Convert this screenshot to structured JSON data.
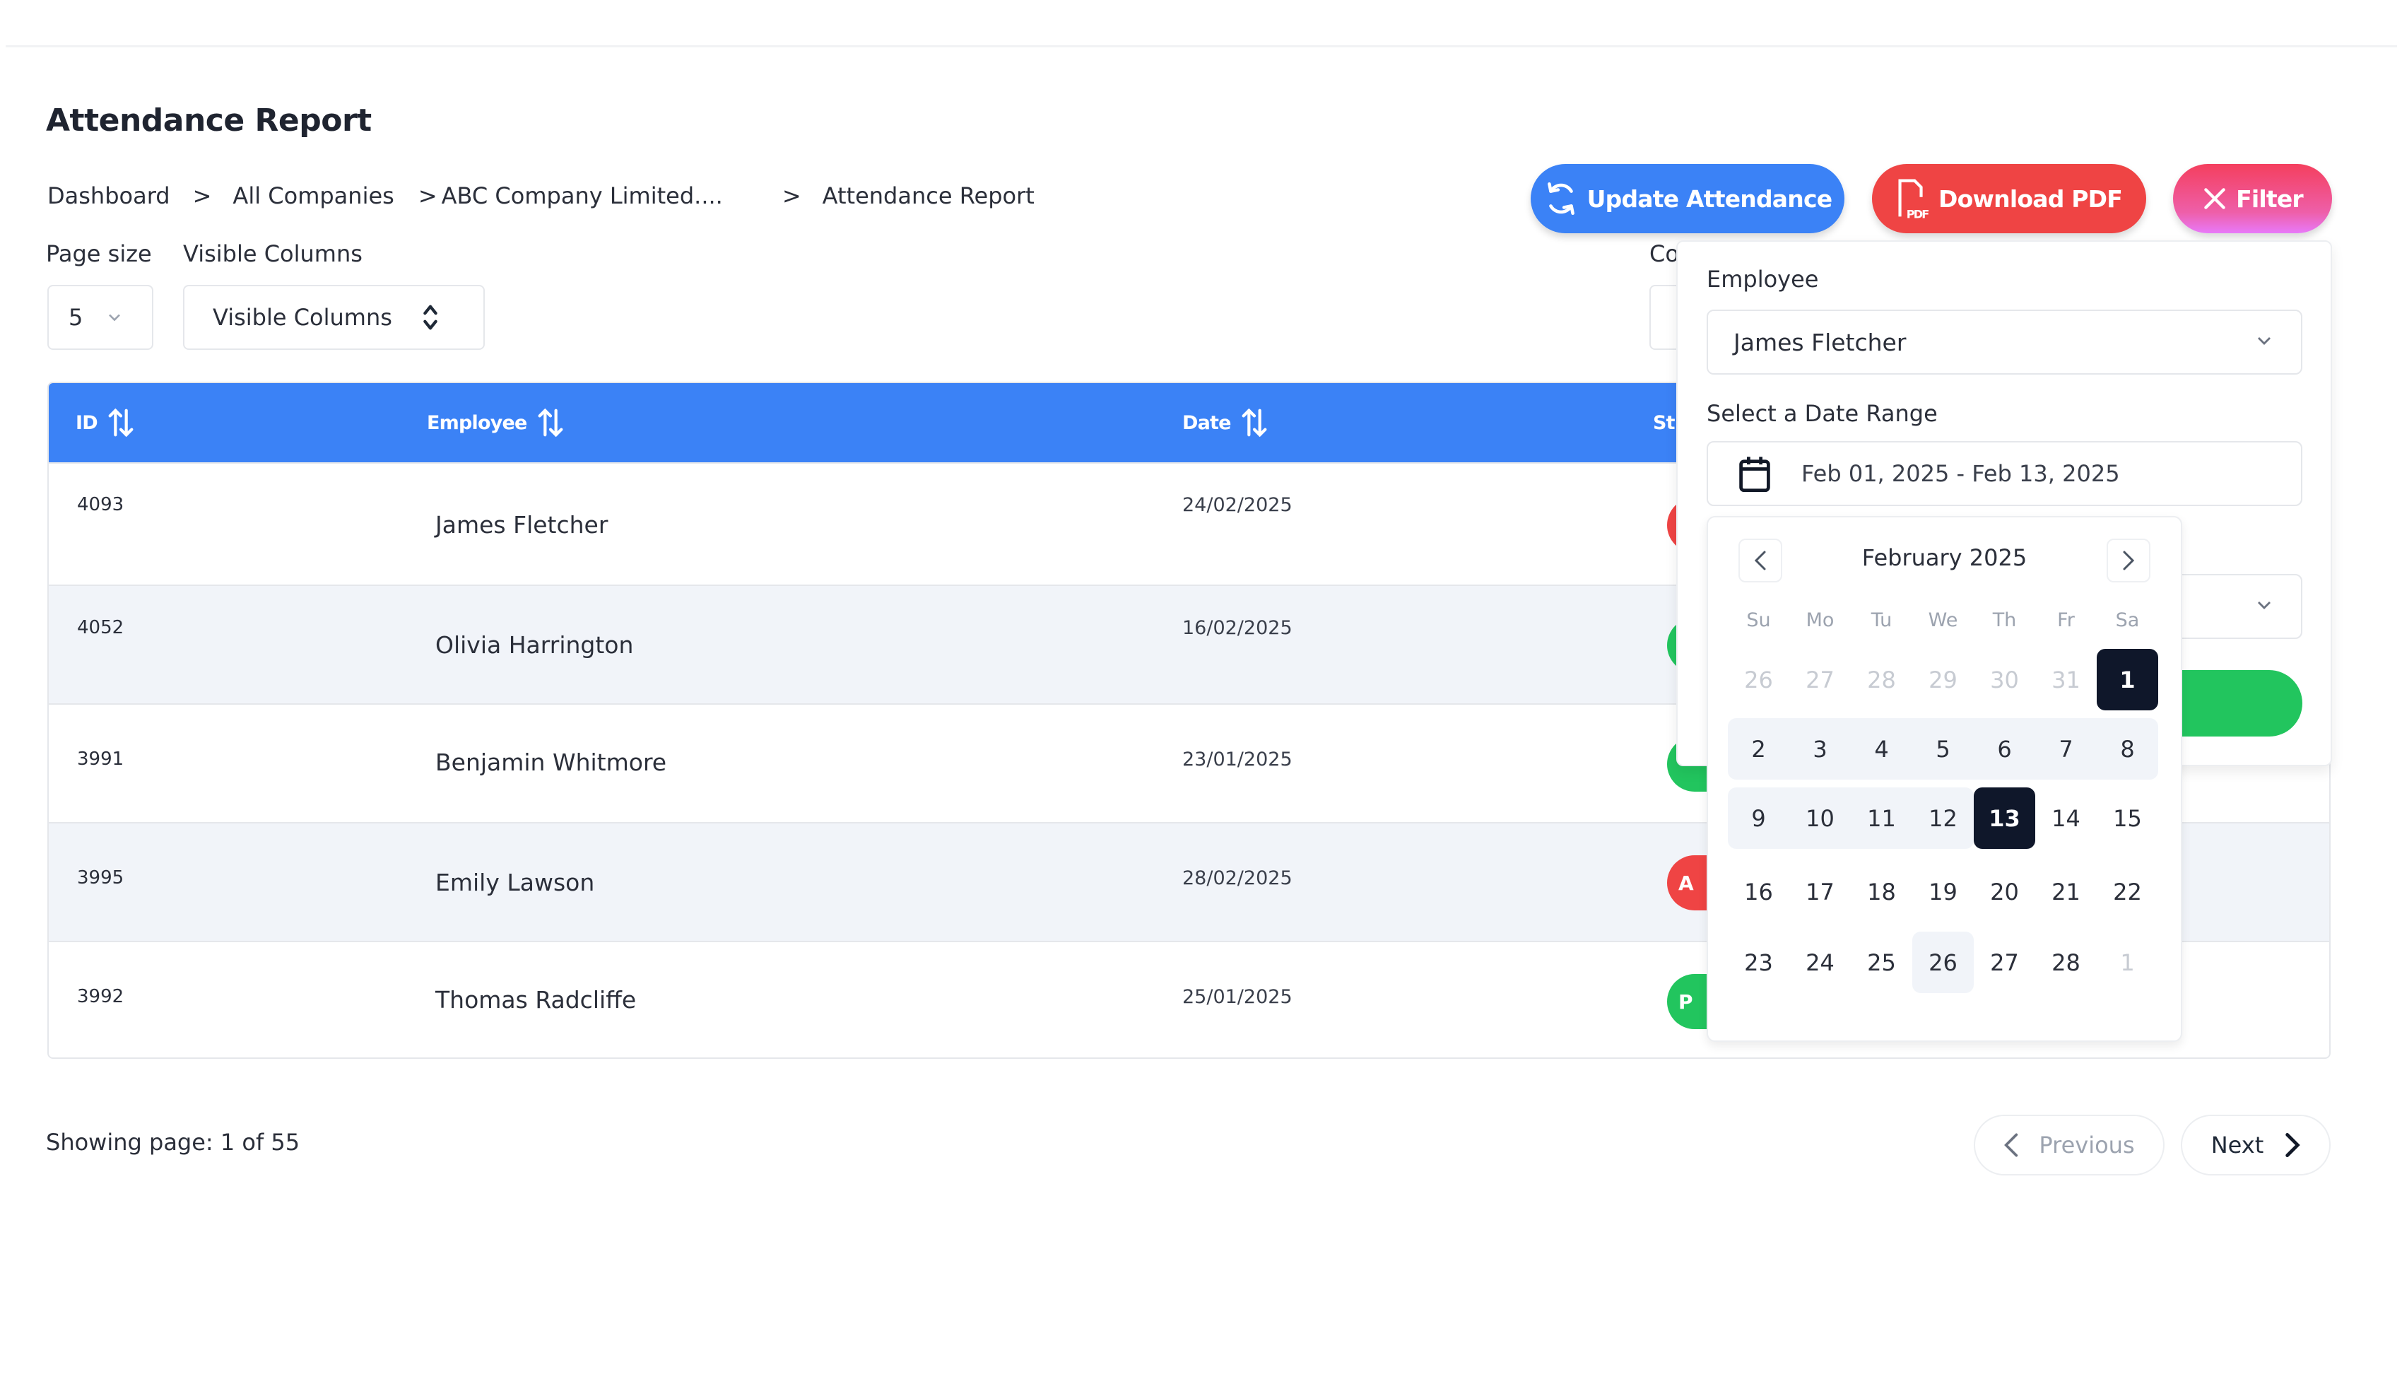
{
  "page": {
    "title": "Attendance Report"
  },
  "breadcrumb": [
    {
      "label": "Dashboard"
    },
    {
      "label": "All Companies"
    },
    {
      "label": "ABC Company Limited...."
    },
    {
      "label": "Attendance Report"
    }
  ],
  "breadcrumb_separator": ">",
  "actions": {
    "update_attendance": "Update Attendance",
    "download_pdf": "Download PDF",
    "filter": "Filter"
  },
  "controls": {
    "page_size_label": "Page size",
    "page_size_value": "5",
    "visible_columns_label": "Visible Columns",
    "visible_columns_value": "Visible Columns",
    "partial_label": "Co"
  },
  "table": {
    "columns": [
      {
        "label": "ID",
        "sortable": true
      },
      {
        "label": "Employee",
        "sortable": true
      },
      {
        "label": "Date",
        "sortable": true
      },
      {
        "label": "St",
        "sortable": false
      }
    ],
    "rows": [
      {
        "id": "4093",
        "employee": "James Fletcher",
        "date": "24/02/2025",
        "status_badge": "",
        "status_color": "#ef4444"
      },
      {
        "id": "4052",
        "employee": "Olivia Harrington",
        "date": "16/02/2025",
        "status_badge": "",
        "status_color": "#22c55e"
      },
      {
        "id": "3991",
        "employee": "Benjamin Whitmore",
        "date": "23/01/2025",
        "status_badge": "",
        "status_color": "#22c55e"
      },
      {
        "id": "3995",
        "employee": "Emily Lawson",
        "date": "28/02/2025",
        "status_badge": "A",
        "status_color": "#ef4444"
      },
      {
        "id": "3992",
        "employee": "Thomas Radcliffe",
        "date": "25/01/2025",
        "status_badge": "P",
        "status_color": "#22c55e"
      }
    ]
  },
  "pagination": {
    "showing_text": "Showing page: 1 of 55",
    "current_page": 1,
    "total_pages": 55,
    "previous_label": "Previous",
    "next_label": "Next"
  },
  "filter_panel": {
    "employee_label": "Employee",
    "employee_value": "James Fletcher",
    "date_range_label": "Select a Date Range",
    "date_range_value": "Feb 01, 2025 - Feb 13, 2025"
  },
  "calendar": {
    "month_title": "February 2025",
    "weekdays": [
      "Su",
      "Mo",
      "Tu",
      "We",
      "Th",
      "Fr",
      "Sa"
    ],
    "weeks": [
      [
        {
          "d": "26",
          "outside": true
        },
        {
          "d": "27",
          "outside": true
        },
        {
          "d": "28",
          "outside": true
        },
        {
          "d": "29",
          "outside": true
        },
        {
          "d": "30",
          "outside": true
        },
        {
          "d": "31",
          "outside": true
        },
        {
          "d": "1",
          "selected": true
        }
      ],
      [
        {
          "d": "2",
          "range": true
        },
        {
          "d": "3",
          "range": true
        },
        {
          "d": "4",
          "range": true
        },
        {
          "d": "5",
          "range": true
        },
        {
          "d": "6",
          "range": true
        },
        {
          "d": "7",
          "range": true
        },
        {
          "d": "8",
          "range": true
        }
      ],
      [
        {
          "d": "9",
          "range": true
        },
        {
          "d": "10",
          "range": true
        },
        {
          "d": "11",
          "range": true
        },
        {
          "d": "12",
          "range": true
        },
        {
          "d": "13",
          "selected": true
        },
        {
          "d": "14"
        },
        {
          "d": "15"
        }
      ],
      [
        {
          "d": "16"
        },
        {
          "d": "17"
        },
        {
          "d": "18"
        },
        {
          "d": "19"
        },
        {
          "d": "20"
        },
        {
          "d": "21"
        },
        {
          "d": "22"
        }
      ],
      [
        {
          "d": "23"
        },
        {
          "d": "24"
        },
        {
          "d": "25"
        },
        {
          "d": "26",
          "today": true
        },
        {
          "d": "27"
        },
        {
          "d": "28"
        },
        {
          "d": "1",
          "outside": true
        }
      ]
    ]
  },
  "colors": {
    "primary": "#3b82f6",
    "danger": "#ef4444",
    "success": "#22c55e",
    "dark": "#0f172a",
    "row_alt": "#f1f4f9"
  }
}
